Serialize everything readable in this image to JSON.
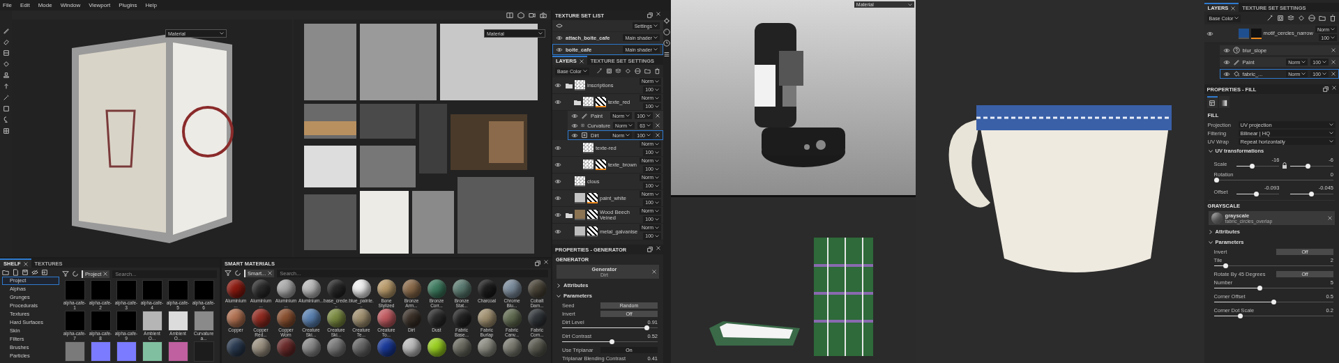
{
  "menu": [
    "File",
    "Edit",
    "Mode",
    "Window",
    "Viewport",
    "Plugins",
    "Help"
  ],
  "viewports": [
    {
      "kind": "model",
      "dropdown": "Material"
    },
    {
      "kind": "texture",
      "dropdown": "Material"
    }
  ],
  "texture_set_list": {
    "title": "TEXTURE SET LIST",
    "settings": "Settings",
    "items": [
      {
        "name": "attach_boite_cafe",
        "shader": "Main shader",
        "selected": false
      },
      {
        "name": "boite_cafe",
        "shader": "Main shader",
        "selected": true
      }
    ]
  },
  "layers_panel": {
    "tabs": [
      {
        "label": "LAYERS",
        "selected": true
      },
      {
        "label": "TEXTURE SET SETTINGS",
        "selected": false
      }
    ],
    "channel": "Base Color",
    "layers": [
      {
        "name": "inscriptions",
        "kind": "folder",
        "blend": "Norm",
        "opacity": "100",
        "mask": false,
        "selected": false,
        "children": [
          {
            "name": "texte_red",
            "kind": "folder",
            "blend": "Norm",
            "opacity": "100",
            "mask": true,
            "mask_active": true,
            "selected": false,
            "effects": [
              {
                "name": "Paint",
                "kind": "paint",
                "blend": "Norm",
                "opacity": "100",
                "selected": false
              },
              {
                "name": "Curvature",
                "kind": "generator",
                "blend": "Norm",
                "opacity": "63",
                "selected": false
              },
              {
                "name": "Dirt",
                "kind": "generator",
                "blend": "Norm",
                "opacity": "100",
                "selected": true
              }
            ]
          },
          {
            "name": "texte-red",
            "kind": "layer",
            "blend": "Norm",
            "opacity": "100",
            "mask": false,
            "selected": false
          },
          {
            "name": "texte_brown",
            "kind": "layer",
            "blend": "Norm",
            "opacity": "100",
            "mask": true,
            "mask_active": true,
            "selected": false
          }
        ]
      },
      {
        "name": "clous",
        "kind": "layer",
        "blend": "Norm",
        "opacity": "100",
        "mask": false,
        "selected": false
      },
      {
        "name": "paint_white",
        "kind": "layer",
        "blend": "Norm",
        "opacity": "100",
        "mask": true,
        "mask_active": true,
        "color": "#c4c4c4",
        "selected": false
      },
      {
        "name": "Wood Beech Veined",
        "kind": "folder",
        "blend": "Norm",
        "opacity": "100",
        "mask": true,
        "mask_active": false,
        "color": "#8c7352",
        "selected": false
      },
      {
        "name": "metal_galvanise",
        "kind": "layer",
        "blend": "Norm",
        "opacity": "100",
        "mask": true,
        "mask_active": false,
        "color": "#bdbdbd",
        "selected": false
      }
    ]
  },
  "generator_panel": {
    "title": "PROPERTIES - GENERATOR",
    "section": "GENERATOR",
    "resource": {
      "title": "Generator",
      "name": "Dirt"
    },
    "groups": [
      {
        "label": "Attributes",
        "expanded": false
      },
      {
        "label": "Parameters",
        "expanded": true,
        "params": [
          {
            "kind": "button",
            "label": "Seed",
            "value": "Random"
          },
          {
            "kind": "toggle",
            "label": "Invert",
            "value": "Off",
            "on": false
          },
          {
            "kind": "slider",
            "label": "Dirt Level",
            "reading": "0.91",
            "level": 0.91
          },
          {
            "kind": "slider",
            "label": "Dirt Contrast",
            "reading": "0.52",
            "level": 0.52
          },
          {
            "kind": "toggle",
            "label": "Use Triplanar",
            "value": "On",
            "on": true
          },
          {
            "kind": "reading",
            "label": "Triplanar Blending Contrast",
            "reading": "0.41"
          }
        ]
      }
    ]
  },
  "shelf": {
    "tabs": [
      {
        "label": "SHELF",
        "selected": true
      },
      {
        "label": "TEXTURES",
        "selected": false
      }
    ],
    "categories": [
      {
        "label": "Project",
        "selected": true
      },
      {
        "label": "Alphas",
        "selected": false
      },
      {
        "label": "Grunges",
        "selected": false
      },
      {
        "label": "Procedurals",
        "selected": false
      },
      {
        "label": "Textures",
        "selected": false
      },
      {
        "label": "Hard Surfaces",
        "selected": false
      },
      {
        "label": "Skin",
        "selected": false
      },
      {
        "label": "Filters",
        "selected": false
      },
      {
        "label": "Brushes",
        "selected": false
      },
      {
        "label": "Particles",
        "selected": false
      }
    ],
    "filter": "Project",
    "search_placeholder": "Search...",
    "items": [
      {
        "name": "alpha-cafe-1",
        "color": "#000000"
      },
      {
        "name": "alpha-cafe-2",
        "color": "#000000"
      },
      {
        "name": "alpha-cafe-3",
        "color": "#000000"
      },
      {
        "name": "alpha-cafe-4",
        "color": "#000000"
      },
      {
        "name": "alpha-cafe-5",
        "color": "#000000"
      },
      {
        "name": "alpha-cafe-6",
        "color": "#000000"
      },
      {
        "name": "alpha-cafe-7",
        "color": "#000000"
      },
      {
        "name": "alpha-cafe-8",
        "color": "#000000"
      },
      {
        "name": "alpha-cafe-9",
        "color": "#000000"
      },
      {
        "name": "Ambient O...",
        "color": "#b5b5b5"
      },
      {
        "name": "Ambient O...",
        "color": "#dcdcdc"
      },
      {
        "name": "Curvature a...",
        "color": "#8a8a8a"
      },
      {
        "color": "#7a7a7a"
      },
      {
        "color": "#7b7bff"
      },
      {
        "color": "#7b7bff"
      },
      {
        "color": "#80c0a0"
      },
      {
        "color": "#c060a0"
      },
      {
        "color": "#1c1c1c"
      }
    ]
  },
  "smart_materials": {
    "title": "SMART MATERIALS",
    "filter": "Smart...",
    "search_placeholder": "Search...",
    "items": [
      {
        "name": "Aluminium ...",
        "color": "#8b1a10"
      },
      {
        "name": "Aluminium ...",
        "color": "#2a2a2a"
      },
      {
        "name": "Aluminium ...",
        "color": "#a8a8a8"
      },
      {
        "name": "Aluminium...",
        "color": "#b8b8b8"
      },
      {
        "name": "base_crede...",
        "color": "#262626"
      },
      {
        "name": "blue_painte...",
        "color": "#eeeeee"
      },
      {
        "name": "Bone Stylized",
        "color": "#b89a6a"
      },
      {
        "name": "Bronze Arm...",
        "color": "#8a6a4a"
      },
      {
        "name": "Bronze Corr...",
        "color": "#3d7a5e"
      },
      {
        "name": "Bronze Stat...",
        "color": "#5a7a70"
      },
      {
        "name": "Charcoal",
        "color": "#1c1c1c"
      },
      {
        "name": "Chrome Blu...",
        "color": "#7a8a9a"
      },
      {
        "name": "Cobalt Dam...",
        "color": "#4a4438"
      },
      {
        "name": "Copper",
        "color": "#b07050"
      },
      {
        "name": "Copper Red...",
        "color": "#902a20"
      },
      {
        "name": "Copper Worn",
        "color": "#8a5030"
      },
      {
        "name": "Creature Ski...",
        "color": "#5a80b0"
      },
      {
        "name": "Creature Ski...",
        "color": "#7a8a40"
      },
      {
        "name": "Creature Te...",
        "color": "#a09070"
      },
      {
        "name": "Creature To...",
        "color": "#c05a60"
      },
      {
        "name": "Dirt",
        "color": "#3a3028"
      },
      {
        "name": "Dust",
        "color": "#2a2a2a"
      },
      {
        "name": "Fabric Base...",
        "color": "#222222"
      },
      {
        "name": "Fabric Burlap",
        "color": "#a09070"
      },
      {
        "name": "Fabric Canv...",
        "color": "#606a50"
      },
      {
        "name": "Fabric Com...",
        "color": "#303438"
      },
      {
        "color": "#2a3a50"
      },
      {
        "color": "#9a9080"
      },
      {
        "color": "#6a2a2a"
      },
      {
        "color": "#888888"
      },
      {
        "color": "#777777"
      },
      {
        "color": "#666666"
      },
      {
        "color": "#1a3a9a"
      },
      {
        "color": "#bbbbbb"
      },
      {
        "color": "#9ad020"
      },
      {
        "color": "#6a6a60"
      },
      {
        "color": "#8a8a80"
      },
      {
        "color": "#7a7a70"
      },
      {
        "color": "#5a5a50"
      }
    ]
  },
  "renders": [
    {
      "kind": "coffee_machine",
      "dropdown": "Material"
    },
    {
      "kind": "tin"
    },
    {
      "kind": "cup"
    }
  ],
  "right_layers": {
    "tabs": [
      {
        "label": "LAYERS",
        "selected": true
      },
      {
        "label": "TEXTURE SET SETTINGS",
        "selected": false
      }
    ],
    "channel": "Base Color",
    "layer": {
      "name": "motif_cercles_narrow",
      "blend": "Norm",
      "opacity": "100",
      "color": "#1f4f8f"
    },
    "effects": [
      {
        "name": "blur_slope",
        "kind": "filter",
        "selected": false
      },
      {
        "name": "Paint",
        "kind": "paint",
        "blend": "Norm",
        "opacity": "100",
        "selected": false
      },
      {
        "name": "fabric_...",
        "kind": "fill",
        "blend": "Norm",
        "opacity": "100",
        "selected": true
      }
    ]
  },
  "fill_panel": {
    "title": "PROPERTIES - FILL",
    "icon_tabs": [
      {
        "kind": "material",
        "selected": true
      },
      {
        "kind": "gradient",
        "selected": false
      }
    ],
    "section": "FILL",
    "dropdowns": [
      {
        "label": "Projection",
        "value": "UV projection"
      },
      {
        "label": "Filtering",
        "value": "Bilinear | HQ"
      },
      {
        "label": "UV Wrap",
        "value": "Repeat horizontally"
      }
    ],
    "uv_group": {
      "label": "UV transformations",
      "expanded": true,
      "rows": [
        {
          "kind": "pair",
          "label": "Scale",
          "locked": true,
          "values": [
            {
              "reading": "-16",
              "level": 0.35
            },
            {
              "reading": "-6",
              "level": 0.4
            }
          ]
        },
        {
          "kind": "slider",
          "label": "Rotation",
          "reading": "0",
          "level": 0
        },
        {
          "kind": "pair",
          "label": "Offset",
          "locked": false,
          "values": [
            {
              "reading": "-0.093",
              "level": 0.47
            },
            {
              "reading": "-0.045",
              "level": 0.49
            }
          ]
        }
      ]
    },
    "grayscale": {
      "section": "GRAYSCALE",
      "resource": {
        "title": "grayscale",
        "name": "fabric_circles_overlap"
      },
      "groups": [
        {
          "label": "Attributes",
          "expanded": false
        },
        {
          "label": "Parameters",
          "expanded": true,
          "params": [
            {
              "kind": "toggle",
              "label": "Invert",
              "value": "Off",
              "on": false
            },
            {
              "kind": "slider",
              "label": "Tile",
              "reading": "2",
              "level": 0.08
            },
            {
              "kind": "toggle",
              "label": "Rotate By 45 Degrees",
              "value": "Off",
              "on": false
            },
            {
              "kind": "slider",
              "label": "Number",
              "reading": "5",
              "level": 0.38
            },
            {
              "kind": "slider",
              "label": "Corner Offset",
              "reading": "0.5",
              "level": 0.5
            },
            {
              "kind": "slider",
              "label": "Corner Dot Scale",
              "reading": "0.2",
              "level": 0.21
            }
          ]
        }
      ]
    }
  }
}
